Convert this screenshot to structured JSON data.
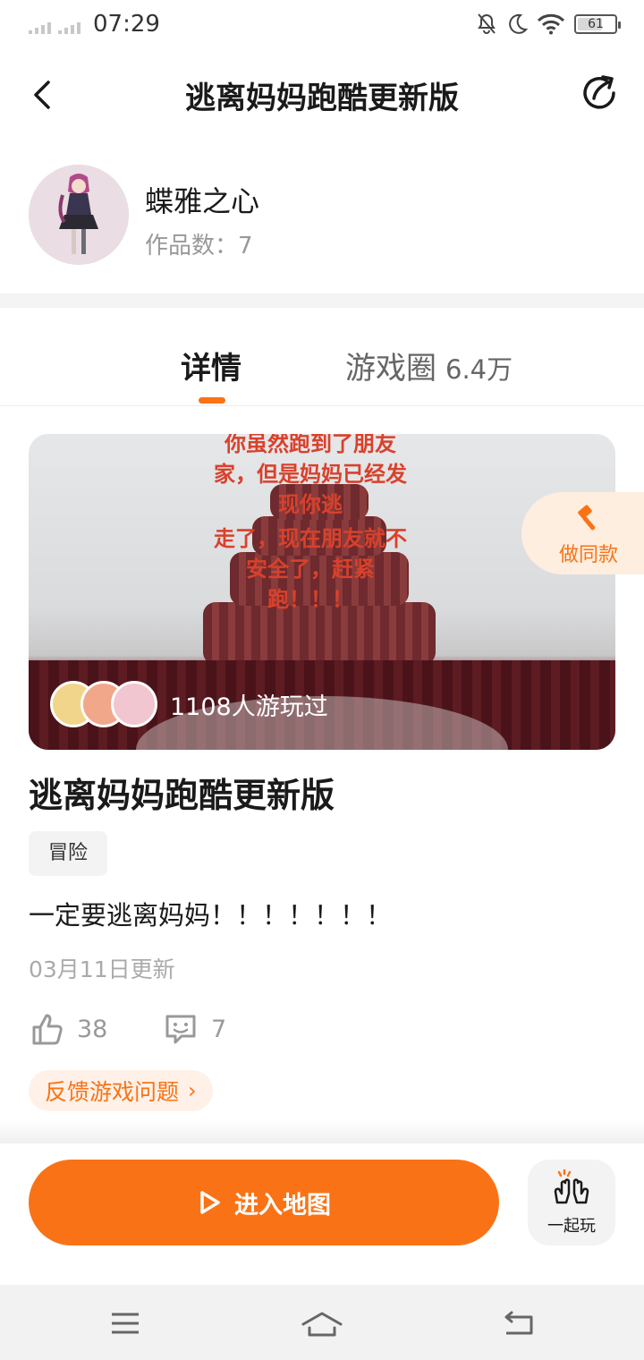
{
  "status_bar": {
    "time": "07:29",
    "battery": "61"
  },
  "header": {
    "title": "逃离妈妈跑酷更新版",
    "back_icon": "chevron-left-icon",
    "share_icon": "share-icon"
  },
  "author": {
    "name": "蝶雅之心",
    "works_label": "作品数：7"
  },
  "tabs": {
    "detail": "详情",
    "circle": "游戏圈",
    "circle_count": "6.4万",
    "active": "detail"
  },
  "cover": {
    "caption_line1": "你虽然跑到了朋友家，但是妈妈已经发现你逃",
    "caption_line2": "走了，现在朋友就不安全了，赶紧跑！！！",
    "players_text": "1108人游玩过"
  },
  "make_same": {
    "label": "做同款",
    "icon": "hammer-icon"
  },
  "game": {
    "title": "逃离妈妈跑酷更新版",
    "tag": "冒险",
    "description": "一定要逃离妈妈！！！！！！！",
    "updated": "03月11日更新",
    "likes": "38",
    "comments": "7"
  },
  "feedback": {
    "label": "反馈游戏问题"
  },
  "actions": {
    "enter": "进入地图",
    "play_together": "一起玩"
  },
  "colors": {
    "accent": "#f97316",
    "accent_light": "#fdeee0"
  }
}
